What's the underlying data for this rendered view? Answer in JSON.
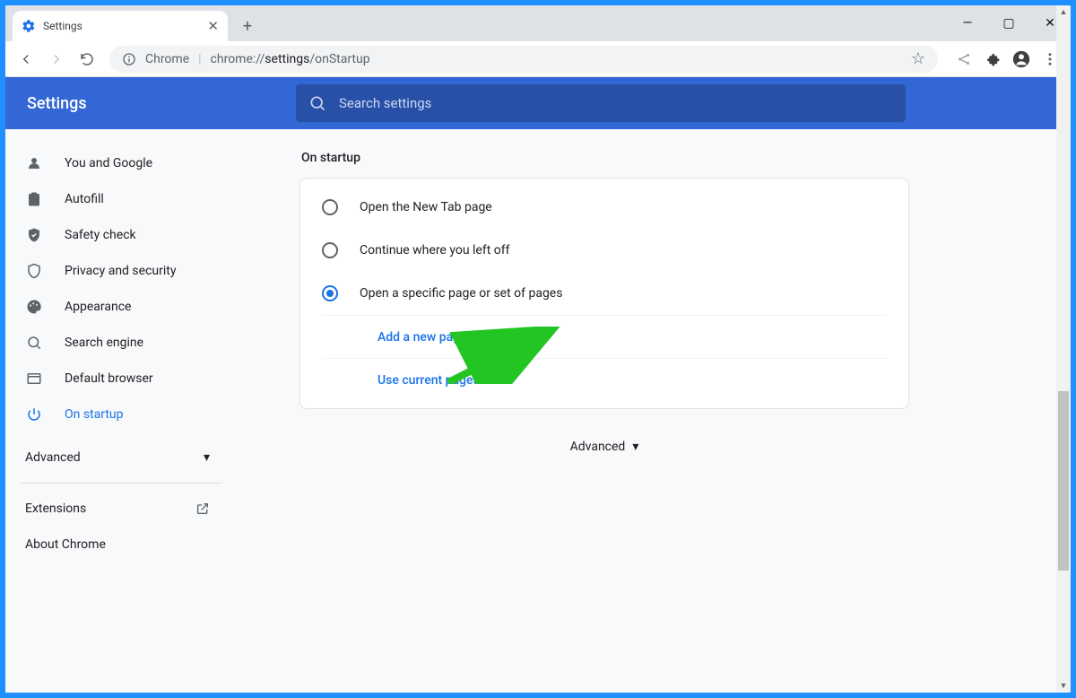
{
  "window": {
    "controls": {
      "minimize": "—",
      "maximize": "▢",
      "close": "✕"
    }
  },
  "tab": {
    "title": "Settings"
  },
  "toolbar": {
    "origin": "Chrome",
    "url_prefix": "chrome://",
    "url_bold": "settings",
    "url_rest": "/onStartup"
  },
  "app": {
    "title": "Settings",
    "search_placeholder": "Search settings"
  },
  "sidebar": {
    "items": [
      {
        "id": "you-and-google",
        "label": "You and Google"
      },
      {
        "id": "autofill",
        "label": "Autofill"
      },
      {
        "id": "safety-check",
        "label": "Safety check"
      },
      {
        "id": "privacy",
        "label": "Privacy and security"
      },
      {
        "id": "appearance",
        "label": "Appearance"
      },
      {
        "id": "search-engine",
        "label": "Search engine"
      },
      {
        "id": "default-browser",
        "label": "Default browser"
      },
      {
        "id": "on-startup",
        "label": "On startup",
        "active": true
      }
    ],
    "advanced_label": "Advanced",
    "extensions_label": "Extensions",
    "about_label": "About Chrome"
  },
  "main": {
    "section_title": "On startup",
    "radios": [
      {
        "id": "new-tab",
        "label": "Open the New Tab page",
        "checked": false
      },
      {
        "id": "continue",
        "label": "Continue where you left off",
        "checked": false
      },
      {
        "id": "specific",
        "label": "Open a specific page or set of pages",
        "checked": true
      }
    ],
    "add_page_label": "Add a new page",
    "use_current_label": "Use current pages",
    "advanced_label": "Advanced"
  },
  "colors": {
    "brand_blue": "#3367d6",
    "link_blue": "#1a73e8",
    "annotation_green": "#22c522"
  }
}
